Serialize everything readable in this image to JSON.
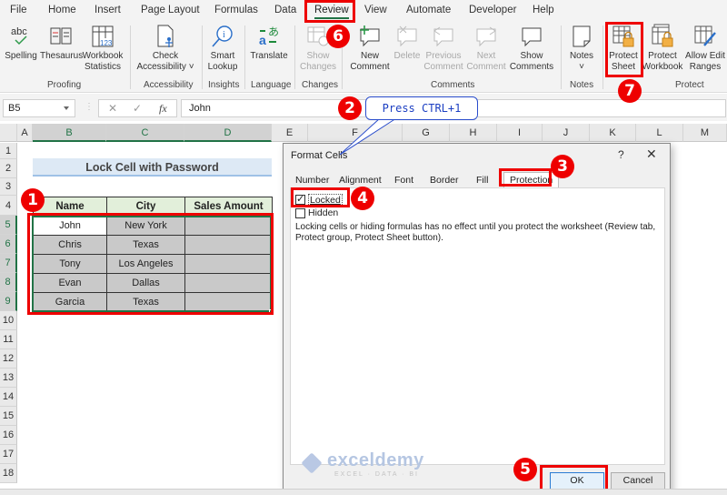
{
  "menu": {
    "tabs": [
      "File",
      "Home",
      "Insert",
      "Page Layout",
      "Formulas",
      "Data",
      "Review",
      "View",
      "Automate",
      "Developer",
      "Help"
    ],
    "active": "Review"
  },
  "ribbon": {
    "buttons": {
      "spelling": "Spelling",
      "thesaurus": "Thesaurus",
      "workbook_statistics_1": "Workbook",
      "workbook_statistics_2": "Statistics",
      "check_accessibility_1": "Check",
      "check_accessibility_2": "Accessibility ˅",
      "smart_lookup_1": "Smart",
      "smart_lookup_2": "Lookup",
      "translate": "Translate",
      "show_changes_1": "Show",
      "show_changes_2": "Changes",
      "new_comment_1": "New",
      "new_comment_2": "Comment",
      "delete": "Delete",
      "previous_comment_1": "Previous",
      "previous_comment_2": "Comment",
      "next_comment_1": "Next",
      "next_comment_2": "Comment",
      "show_comments_1": "Show",
      "show_comments_2": "Comments",
      "notes": "Notes",
      "notes_caret": "˅",
      "protect_sheet_1": "Protect",
      "protect_sheet_2": "Sheet",
      "protect_workbook_1": "Protect",
      "protect_workbook_2": "Workbook",
      "allow_edit_ranges_1": "Allow Edit",
      "allow_edit_ranges_2": "Ranges"
    },
    "groups": {
      "proofing": "Proofing",
      "accessibility": "Accessibility",
      "insights": "Insights",
      "language": "Language",
      "changes": "Changes",
      "comments": "Comments",
      "notes": "Notes",
      "protect": "Protect"
    }
  },
  "formula_bar": {
    "name_box": "B5",
    "cancel_icon": "✕",
    "enter_icon": "✓",
    "fx_label": "fx",
    "value": "John"
  },
  "columns": [
    "A",
    "B",
    "C",
    "D",
    "E",
    "F",
    "G",
    "H",
    "I",
    "J",
    "K",
    "L",
    "M"
  ],
  "rows": [
    "1",
    "2",
    "3",
    "4",
    "5",
    "6",
    "7",
    "8",
    "9",
    "10",
    "11",
    "12",
    "13",
    "14",
    "15",
    "16",
    "17",
    "18"
  ],
  "sheet": {
    "title": "Lock Cell with Password",
    "headers": [
      "Name",
      "City",
      "Sales Amount"
    ],
    "rows": [
      [
        "John",
        "New York",
        ""
      ],
      [
        "Chris",
        "Texas",
        ""
      ],
      [
        "Tony",
        "Los Angeles",
        ""
      ],
      [
        "Evan",
        "Dallas",
        ""
      ],
      [
        "Garcia",
        "Texas",
        ""
      ]
    ]
  },
  "callouts": {
    "bubble_text": "Press CTRL+1",
    "steps": [
      "1",
      "2",
      "3",
      "4",
      "5",
      "6",
      "7"
    ]
  },
  "dialog": {
    "title": "Format Cells",
    "help": "?",
    "close": "✕",
    "tabs": [
      "Number",
      "Alignment",
      "Font",
      "Border",
      "Fill",
      "Protection"
    ],
    "active_tab": "Protection",
    "locked_label": "Locked",
    "locked_checked": true,
    "hidden_label": "Hidden",
    "hidden_checked": false,
    "note": "Locking cells or hiding formulas has no effect until you protect the worksheet (Review tab, Protect group, Protect Sheet button).",
    "ok": "OK",
    "cancel": "Cancel"
  },
  "watermark": {
    "brand": "exceldemy",
    "tagline": "EXCEL · DATA · BI"
  },
  "colors": {
    "accent_green": "#217346",
    "callout_red": "#ee0000",
    "header_fill": "#e2efda",
    "title_fill": "#dde9f5",
    "bubble_blue": "#1c3fc2"
  }
}
